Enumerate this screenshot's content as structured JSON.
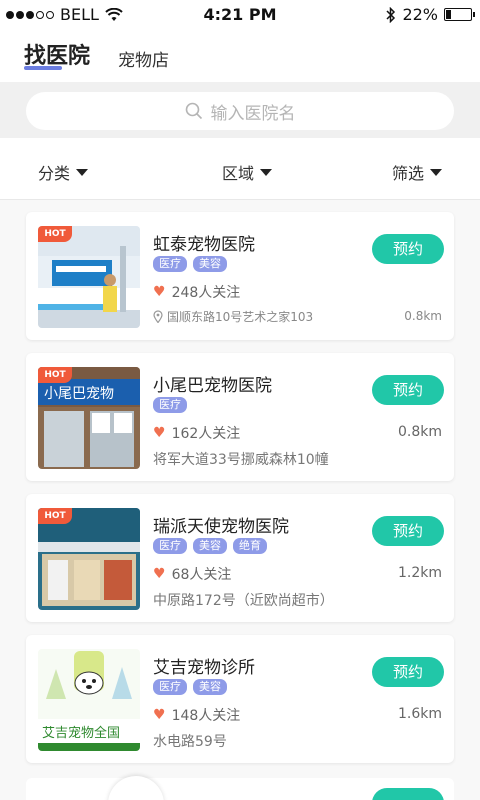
{
  "status_bar": {
    "carrier": "BELL",
    "time": "4:21 PM",
    "battery": "22%",
    "battery_level": 0.22
  },
  "header": {
    "tab_active": "找医院",
    "tab_other": "宠物店",
    "accent_color": "#6b7de0"
  },
  "search": {
    "placeholder": "输入医院名"
  },
  "filters": {
    "category": "分类",
    "region": "区域",
    "filter": "筛选"
  },
  "hospitals": [
    {
      "badge": "HOT",
      "name": "虹泰宠物医院",
      "tags": [
        "医疗",
        "美容"
      ],
      "followers": "248人关注",
      "address": "国顺东路10号艺术之家103",
      "distance": "0.8km",
      "book_label": "预约"
    },
    {
      "badge": "HOT",
      "name": "小尾巴宠物医院",
      "tags": [
        "医疗"
      ],
      "followers": "162人关注",
      "address": "将军大道33号挪威森林10幢",
      "distance": "0.8km",
      "book_label": "预约"
    },
    {
      "badge": "HOT",
      "name": "瑞派天使宠物医院",
      "tags": [
        "医疗",
        "美容",
        "绝育"
      ],
      "followers": "68人关注",
      "address": "中原路172号（近欧尚超市）",
      "distance": "1.2km",
      "book_label": "预约"
    },
    {
      "badge": "",
      "name": "艾吉宠物诊所",
      "tags": [
        "医疗",
        "美容"
      ],
      "followers": "148人关注",
      "address": "水电路59号",
      "distance": "1.6km",
      "book_label": "预约",
      "logo_text": "艾吉宠物全国"
    }
  ],
  "colors": {
    "book_button": "#21c7a8",
    "tag": "#8e9be8",
    "hot_badge": "#f05a3a",
    "heart": "#f07050"
  }
}
